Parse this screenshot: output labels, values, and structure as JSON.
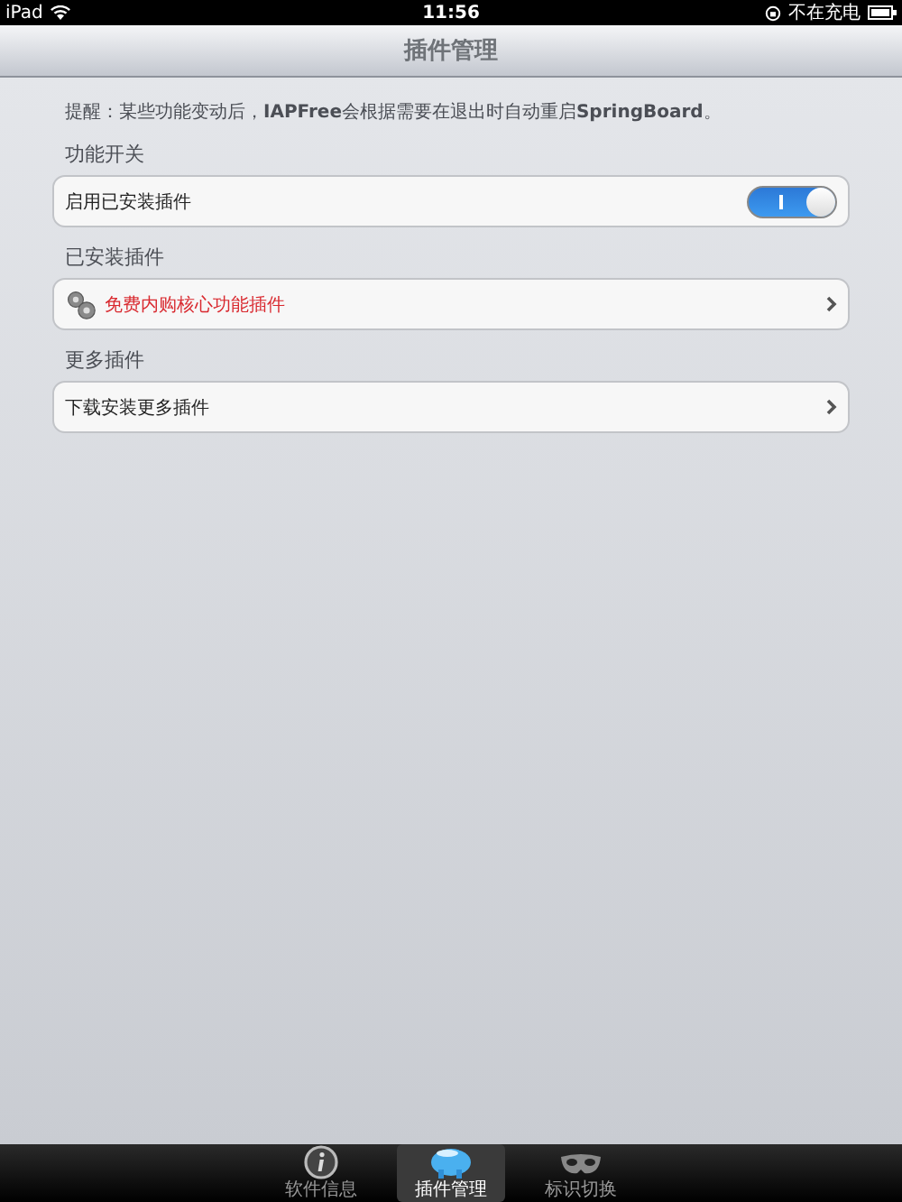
{
  "status_bar": {
    "device": "iPad",
    "time": "11:56",
    "charging": "不在充电"
  },
  "nav_bar": {
    "title": "插件管理"
  },
  "notice": "提醒：某些功能变动后，**IAPFree**会根据需要在退出时自动重启**SpringBoard**。",
  "sections": [
    {
      "header": "功能开关",
      "rows": [
        {
          "kind": "switch",
          "label": "启用已安装插件",
          "on": true
        }
      ]
    },
    {
      "header": "已安装插件",
      "rows": [
        {
          "kind": "plugin",
          "label": "免费内购核心功能插件"
        }
      ]
    },
    {
      "header": "更多插件",
      "rows": [
        {
          "kind": "link",
          "label": "下载安装更多插件"
        }
      ]
    }
  ],
  "tab_bar": [
    {
      "label": "软件信息",
      "selected": false
    },
    {
      "label": "插件管理",
      "selected": true
    },
    {
      "label": "标识切换",
      "selected": false
    }
  ]
}
